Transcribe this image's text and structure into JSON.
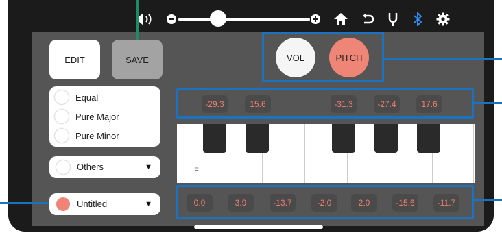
{
  "colors": {
    "panel": "#555555",
    "accent_blue": "#1a72c0",
    "pitch_active": "#ef8577",
    "chip_text": "#ef7f6f",
    "bluetooth": "#2f8cf0",
    "save_pointer": "#1e8a6a"
  },
  "toolbar": {
    "icons": [
      "speaker-icon",
      "minus-icon",
      "volume-slider",
      "plus-icon",
      "home-icon",
      "undo-icon",
      "tuning-fork-icon",
      "bluetooth-icon",
      "gear-icon"
    ],
    "volume_level": 0.31
  },
  "buttons": {
    "edit_label": "EDIT",
    "save_label": "SAVE",
    "vol_label": "VOL",
    "pitch_label": "PITCH"
  },
  "temperaments": [
    {
      "label": "Equal"
    },
    {
      "label": "Pure Major"
    },
    {
      "label": "Pure Minor"
    }
  ],
  "others_dropdown": {
    "label": "Others",
    "arrow": "▼"
  },
  "preset_dropdown": {
    "label": "Untitled",
    "arrow": "▼",
    "color": "#ef8577"
  },
  "black_key_offsets": [
    "-29.3",
    "15.6",
    "-31.3",
    "-27.4",
    "17.6"
  ],
  "white_key_offsets": [
    "0.0",
    "3.9",
    "-13.7",
    "-2.0",
    "2.0",
    "-15.6",
    "-11.7"
  ],
  "keyboard": {
    "first_key_label": "F"
  }
}
